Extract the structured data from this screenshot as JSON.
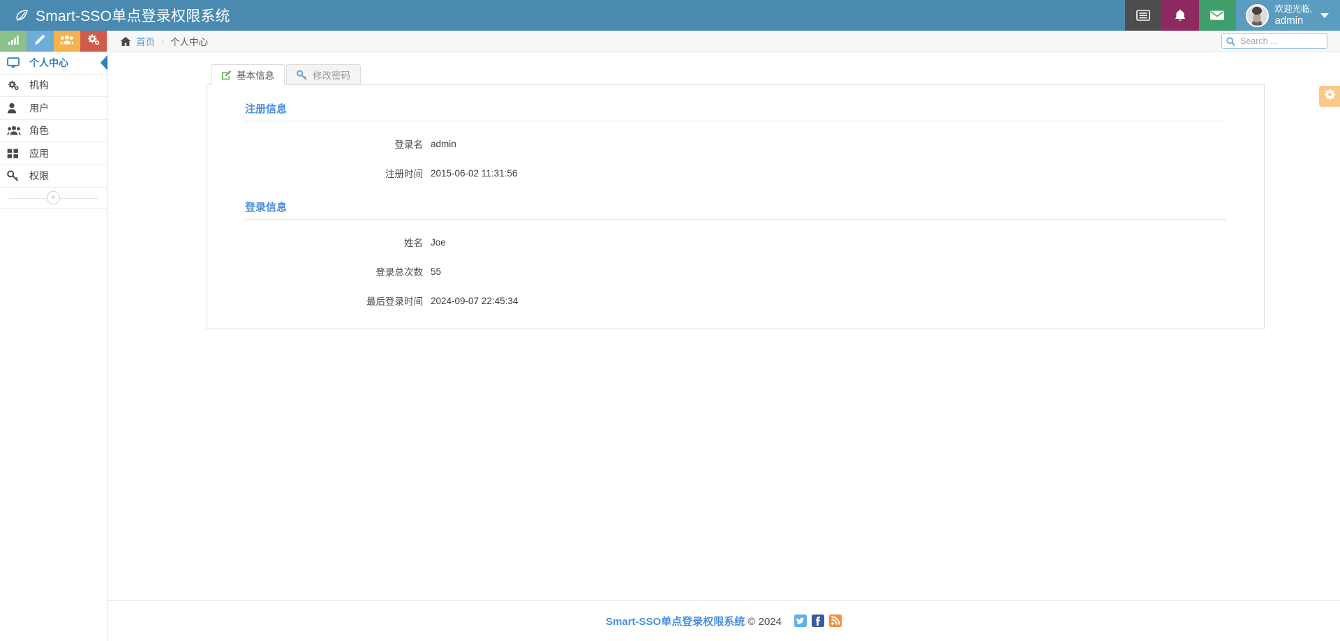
{
  "navbar": {
    "brand": "Smart-SSO单点登录权限系统",
    "brand_icon": "leaf-icon",
    "toggle_icon": "list-lines-icon",
    "bell_icon": "bell-icon",
    "mail_icon": "envelope-icon",
    "welcome": "欢迎光临,",
    "username": "admin",
    "colors": {
      "navbar_bg": "#4b8ab0",
      "toggle_bg": "#4d4d4d",
      "bell_bg": "#8f2a61",
      "mail_bg": "#3f9e6c",
      "user_bg": "#5b9cc1"
    }
  },
  "sidebar": {
    "quick_buttons": [
      {
        "name": "chart-bars-icon",
        "color": "#8ac08a"
      },
      {
        "name": "pencil-icon",
        "color": "#6eadd8"
      },
      {
        "name": "users-icon",
        "color": "#f4b350"
      },
      {
        "name": "gears-icon",
        "color": "#d15b4a"
      }
    ],
    "items": [
      {
        "label": "个人中心",
        "icon": "desktop-icon",
        "active": true
      },
      {
        "label": "机构",
        "icon": "gears-icon",
        "active": false
      },
      {
        "label": "用户",
        "icon": "user-icon",
        "active": false
      },
      {
        "label": "角色",
        "icon": "group-icon",
        "active": false
      },
      {
        "label": "应用",
        "icon": "grid-squares-icon",
        "active": false
      },
      {
        "label": "权限",
        "icon": "key-icon",
        "active": false
      }
    ],
    "collapse_label": "«",
    "active_color": "#2f7fbb"
  },
  "breadcrumb": {
    "home_icon": "home-icon",
    "home": "首页",
    "separator": "›",
    "current": "个人中心"
  },
  "search": {
    "placeholder": "Search ...",
    "value": "",
    "icon": "search-icon"
  },
  "gear_fab": {
    "icon": "gear-icon",
    "color": "#fbc888"
  },
  "tabs": [
    {
      "label": "基本信息",
      "icon": "edit-square-icon",
      "active": true
    },
    {
      "label": "修改密码",
      "icon": "key-icon",
      "active": false
    }
  ],
  "sections": [
    {
      "title": "注册信息",
      "rows": [
        {
          "label": "登录名",
          "value": "admin"
        },
        {
          "label": "注册时间",
          "value": "2015-06-02 11:31:56"
        }
      ]
    },
    {
      "title": "登录信息",
      "rows": [
        {
          "label": "姓名",
          "value": "Joe"
        },
        {
          "label": "登录总次数",
          "value": "55"
        },
        {
          "label": "最后登录时间",
          "value": "2024-09-07 22:45:34"
        }
      ]
    }
  ],
  "footer": {
    "brand": "Smart-SSO单点登录权限系统",
    "copyright": "© 2024",
    "social": [
      {
        "name": "twitter-icon",
        "color": "#5eb2e8"
      },
      {
        "name": "facebook-icon",
        "color": "#3b5a9b"
      },
      {
        "name": "rss-icon",
        "color": "#f5903a"
      }
    ]
  }
}
